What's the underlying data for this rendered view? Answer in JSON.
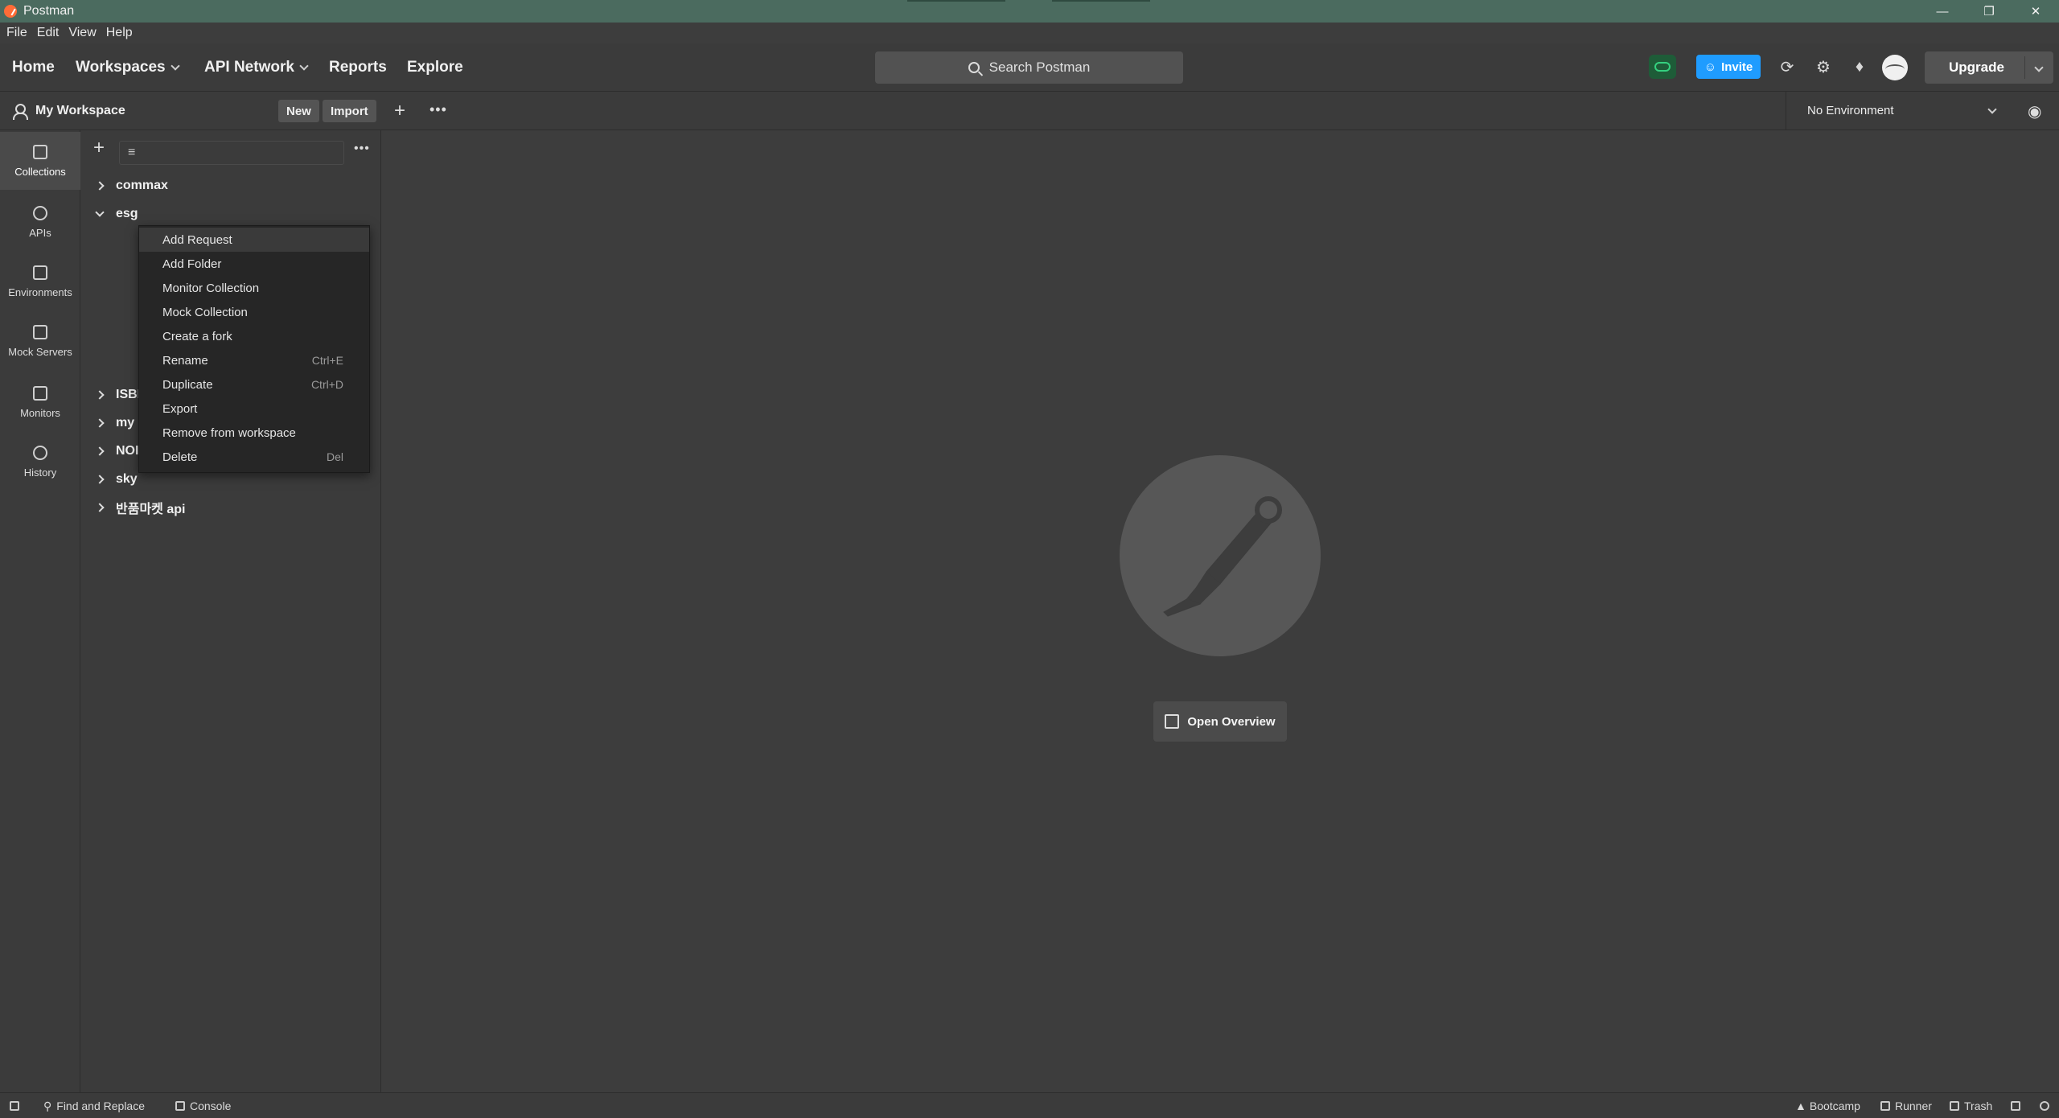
{
  "window": {
    "title": "Postman"
  },
  "menu": [
    "File",
    "Edit",
    "View",
    "Help"
  ],
  "header": {
    "home": "Home",
    "workspaces": "Workspaces",
    "api_network": "API Network",
    "reports": "Reports",
    "explore": "Explore",
    "search_placeholder": "Search Postman",
    "invite": "Invite",
    "upgrade": "Upgrade"
  },
  "workspace": {
    "name": "My Workspace",
    "new": "New",
    "import": "Import"
  },
  "environment": {
    "selected": "No Environment"
  },
  "rail": [
    "Collections",
    "APIs",
    "Environments",
    "Mock Servers",
    "Monitors",
    "History"
  ],
  "collections": [
    {
      "name": "commax",
      "expanded": false
    },
    {
      "name": "esg",
      "expanded": true
    },
    {
      "name": "ISBI",
      "expanded": false
    },
    {
      "name": "my",
      "expanded": false
    },
    {
      "name": "NOI",
      "expanded": false
    },
    {
      "name": "sky",
      "expanded": false
    },
    {
      "name": "반품마켓 api",
      "expanded": false
    }
  ],
  "context_menu": [
    {
      "label": "Add Request",
      "shortcut": ""
    },
    {
      "label": "Add Folder",
      "shortcut": ""
    },
    {
      "label": "Monitor Collection",
      "shortcut": ""
    },
    {
      "label": "Mock Collection",
      "shortcut": ""
    },
    {
      "label": "Create a fork",
      "shortcut": ""
    },
    {
      "label": "Rename",
      "shortcut": "Ctrl+E"
    },
    {
      "label": "Duplicate",
      "shortcut": "Ctrl+D"
    },
    {
      "label": "Export",
      "shortcut": ""
    },
    {
      "label": "Remove from workspace",
      "shortcut": ""
    },
    {
      "label": "Delete",
      "shortcut": "Del"
    }
  ],
  "main": {
    "open_overview": "Open Overview"
  },
  "statusbar": {
    "find_replace": "Find and Replace",
    "console": "Console",
    "bootcamp": "Bootcamp",
    "runner": "Runner",
    "trash": "Trash"
  },
  "colors": {
    "accent": "#ff6c37",
    "invite": "#1f9cff",
    "sync": "#35d07f",
    "titlebar": "#4b6b5f"
  }
}
